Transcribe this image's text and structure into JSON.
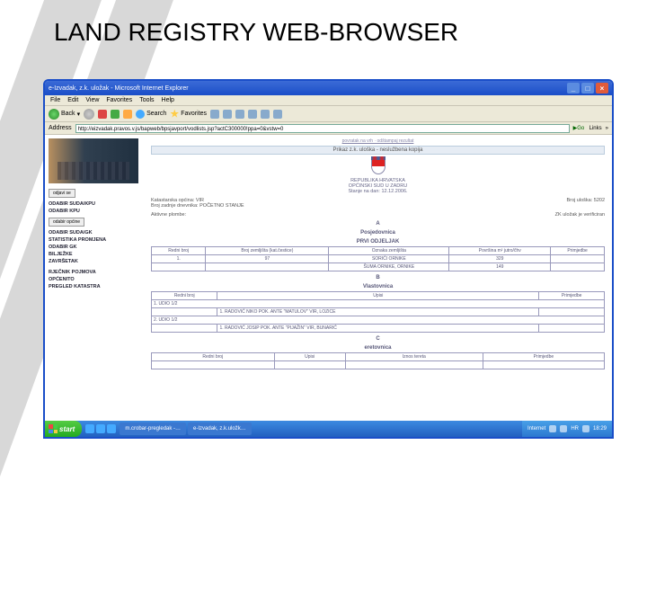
{
  "slide": {
    "title": "LAND REGISTRY WEB-BROWSER"
  },
  "window": {
    "title": "e-Izvadak, z.k. uložak - Microsoft Internet Explorer",
    "min": "_",
    "max": "□",
    "close": "×"
  },
  "menu": {
    "file": "File",
    "edit": "Edit",
    "view": "View",
    "favorites": "Favorites",
    "tools": "Tools",
    "help": "Help"
  },
  "toolbar": {
    "back": "Back",
    "search": "Search",
    "favorites": "Favorites"
  },
  "address": {
    "label": "Address",
    "url": "http://eizvadak.pravos.v.js/bapweb/bpsjavport/vodlists.jsp?actC300000!ppa=0&vstw=0",
    "go": "Go",
    "links": "Links",
    "chev": "»"
  },
  "sidebar": {
    "btn_logout": "odjavi se",
    "items": [
      "ODABIR SUDA/KPU",
      "ODABIR KPU",
      "odabir općine",
      "ODABIR SUDA/GK",
      "STATISTIKA PROMJENA",
      "ODABIR GK",
      "BILJEŽKE",
      "ZAVRŠETAK",
      "RJEČNIK POJMOVA",
      "OPĆENITO",
      "PREGLED KATASTRA"
    ]
  },
  "doc": {
    "toplinks": "povratak na vrh · odštampaj rezultat",
    "heading": "Prikaz z.k. uloška - neslužbena kopija",
    "country": "REPUBLIKA HRVATSKA",
    "court": "OPĆINSKI SUD U ZADRU",
    "date_lbl": "Stanje na dan: 12.12.2006.",
    "kat_lbl": "Katastarska općina: VIR",
    "broj_lbl": "Broj zadnje dnevnika: POČETNO STANJE",
    "akt_lbl": "Aktivne plombe:",
    "ver_lbl": "ZK uložak je verificiran",
    "ulozak_lbl": "Broj uloška: 5202",
    "secA": "A",
    "secA_sub": "Posjedovnica",
    "secA_sub2": "PRVI ODJELJAK",
    "thA": [
      "Redni broj",
      "Broj zemljišta (kat.čestice)",
      "Oznaka zemljišta",
      "Površina m² jutro/čhv",
      "Primjedbe"
    ],
    "rowA1": [
      "1.",
      "97",
      "SORIĆI ORNIKE",
      "329",
      ""
    ],
    "rowA2": [
      "",
      "",
      "ŠUMA ORNIKE, ORNIKE",
      "149",
      ""
    ],
    "secB": "B",
    "secB_sub": "Vlastovnica",
    "thB": [
      "Redni broj",
      "",
      "Upisi",
      "",
      "Primjedbe"
    ],
    "own1_lbl": "1. UDIO 1/2",
    "own1_val": "1. RADOVIĆ NIKO POK. ANTE \"MATULOV\" VIR, LOZICE",
    "own2_lbl": "2. UDIO 1/2",
    "own2_val": "1. RADOVIĆ JOSIP POK. ANTE \"PIJAŽIN\" VIR, BUNARIĆ",
    "secC": "C",
    "secC_sub": "eretovnica",
    "thC": [
      "Redni broj",
      "",
      "Upisi",
      "Iznos tereta",
      "Primjedbe"
    ]
  },
  "taskbar": {
    "start": "start",
    "tasks": [
      "m.crobar-pregledak -…",
      "e-Izvadak, z.k.uložk…"
    ],
    "lang": "HR",
    "time": "18:29",
    "net": "Internet"
  }
}
